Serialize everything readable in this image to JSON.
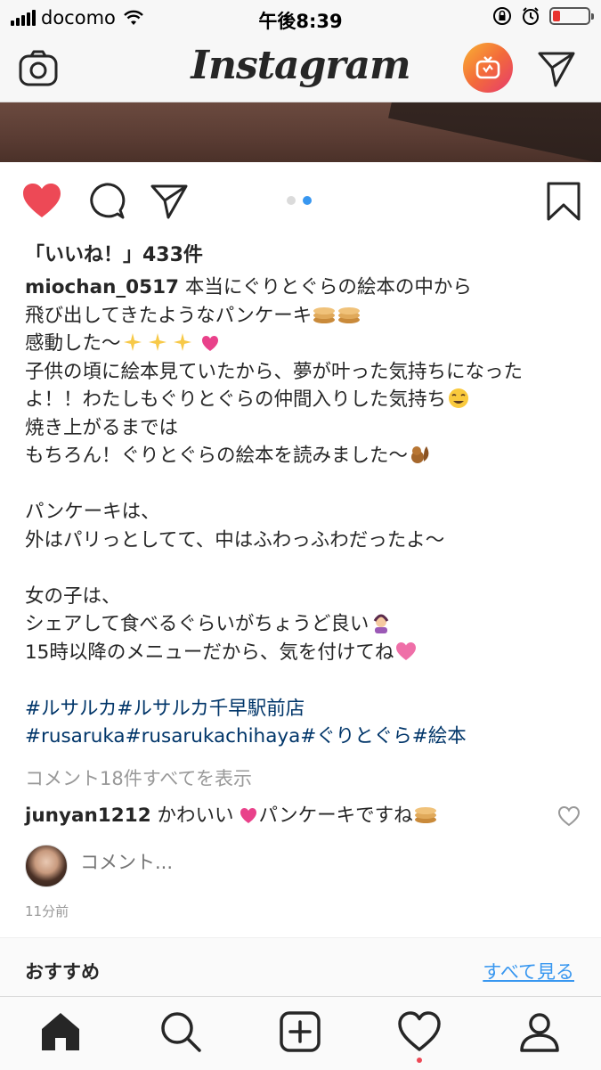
{
  "status_bar": {
    "carrier": "docomo",
    "time": "午後8:39",
    "battery_color": "#e8332e"
  },
  "nav": {
    "logo_text": "Instagram",
    "igtv_gradient": [
      "#f9b233",
      "#e63a6f"
    ]
  },
  "post": {
    "likes": "「いいね！」433件",
    "carousel": {
      "count": 2,
      "active_index": 1,
      "active_color": "#3897f0"
    },
    "caption": {
      "username": "miochan_0517",
      "l1": "本当にぐりとぐらの絵本の中から",
      "l2": "飛び出してきたようなパンケーキ",
      "l3": "感動した〜",
      "l4": "子供の頃に絵本見ていたから、夢が叶った気持ちになった",
      "l5": "よ！！わたしもぐりとぐらの仲間入りした気持ち",
      "l6": "焼き上がるまでは",
      "l7": "もちろん！ぐりとぐらの絵本を読みました〜",
      "l8": "パンケーキは、",
      "l9": "外はパリっとしてて、中はふわっふわだったよ〜",
      "l10": "女の子は、",
      "l11": "シェアして食べるぐらいがちょうど良い",
      "l12": "15時以降のメニューだから、気を付けてね",
      "hashtags_1": "#ルサルカ#ルサルカ千早駅前店",
      "hashtags_2": "#rusaruka#rusarukachihaya#ぐりとぐら#絵本"
    },
    "view_comments": "コメント18件すべてを表示",
    "comment": {
      "username": "junyan1212",
      "text_a": "かわいい",
      "text_b": "パンケーキですね"
    },
    "add_comment_placeholder": "コメント...",
    "time_ago": "11分前"
  },
  "suggestions": {
    "title": "おすすめ",
    "see_all": "すべて見る"
  },
  "tab_bar": {
    "items": [
      "home-icon",
      "search-icon",
      "add-post-icon",
      "activity-heart-icon",
      "profile-icon"
    ],
    "activity_dot_color": "#ed4956"
  },
  "colors": {
    "like_red": "#ed4956",
    "hashtag": "#003569",
    "link_blue": "#3897f0"
  }
}
